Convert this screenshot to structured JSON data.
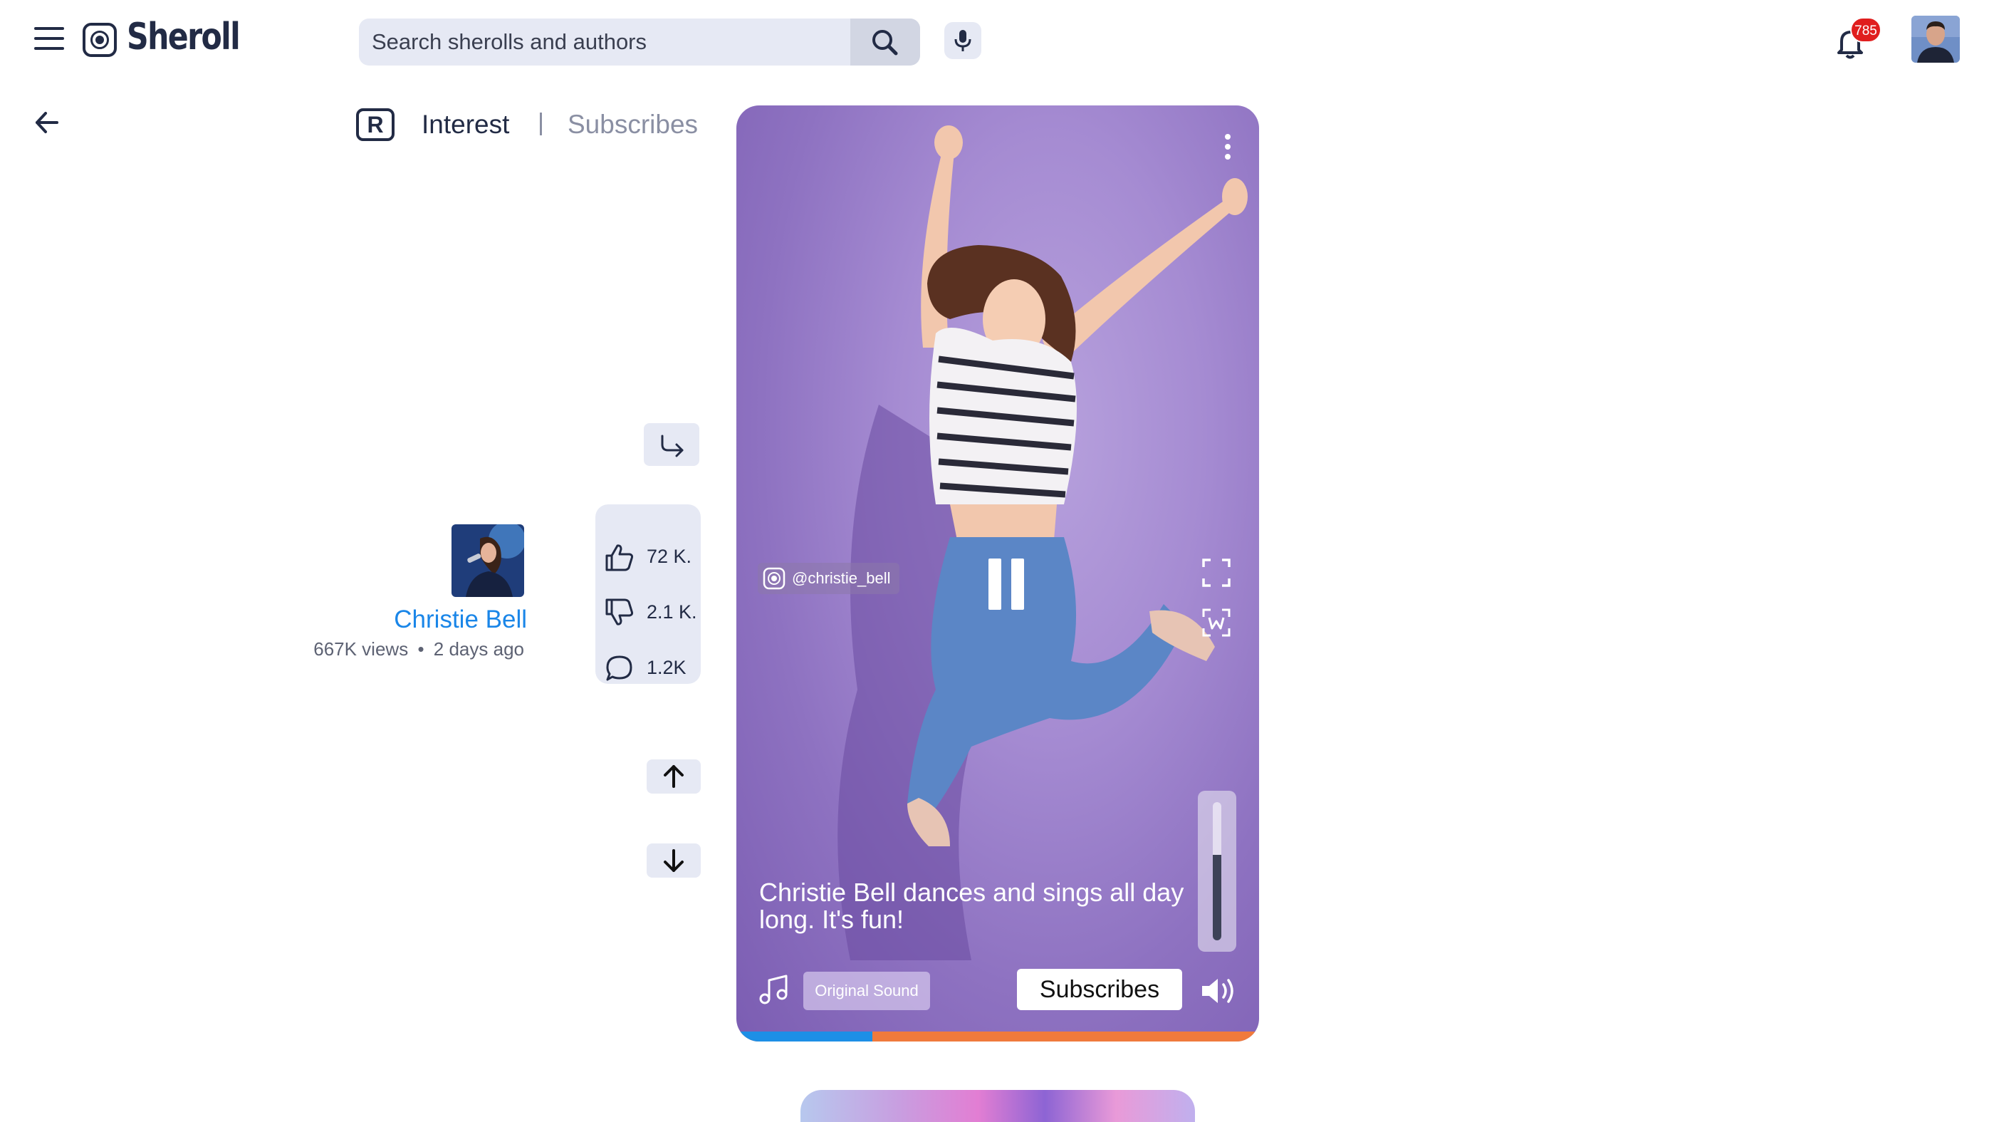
{
  "header": {
    "brand": "Sheroll",
    "search": {
      "placeholder": "Search sherolls and authors",
      "value": ""
    },
    "notifications_count": "785"
  },
  "feed_tabs": {
    "badge": "R",
    "items": [
      {
        "label": "Interest",
        "active": true
      },
      {
        "label": "Subscribes",
        "active": false
      }
    ]
  },
  "author": {
    "name": "Christie Bell",
    "views": "667K views",
    "separator": "•",
    "posted": "2 days ago"
  },
  "stats": {
    "likes": "72 K.",
    "dislikes": "2.1 K.",
    "comments": "1.2K"
  },
  "video": {
    "handle": "@christie_bell",
    "caption": "Christie Bell dances and sings all day long. It's fun!",
    "sound_label": "Original Sound",
    "subscribe_label": "Subscribes",
    "volume_level": 0.62,
    "progress_fraction": 0.26,
    "state": "playing"
  },
  "colors": {
    "brand_dark": "#222b45",
    "accent_blue": "#1a86e8",
    "progress_played": "#1d8fe6",
    "progress_remaining": "#f07a3c",
    "badge_red": "#e01e1e"
  },
  "icons": [
    "menu-icon",
    "sheroll-logo-icon",
    "search-icon",
    "mic-icon",
    "bell-icon",
    "back-arrow-icon",
    "share-icon",
    "thumbs-up-icon",
    "thumbs-down-icon",
    "comment-icon",
    "arrow-up-icon",
    "arrow-down-icon",
    "more-vertical-icon",
    "pause-icon",
    "fullscreen-icon",
    "watermark-icon",
    "music-note-icon",
    "volume-icon"
  ]
}
